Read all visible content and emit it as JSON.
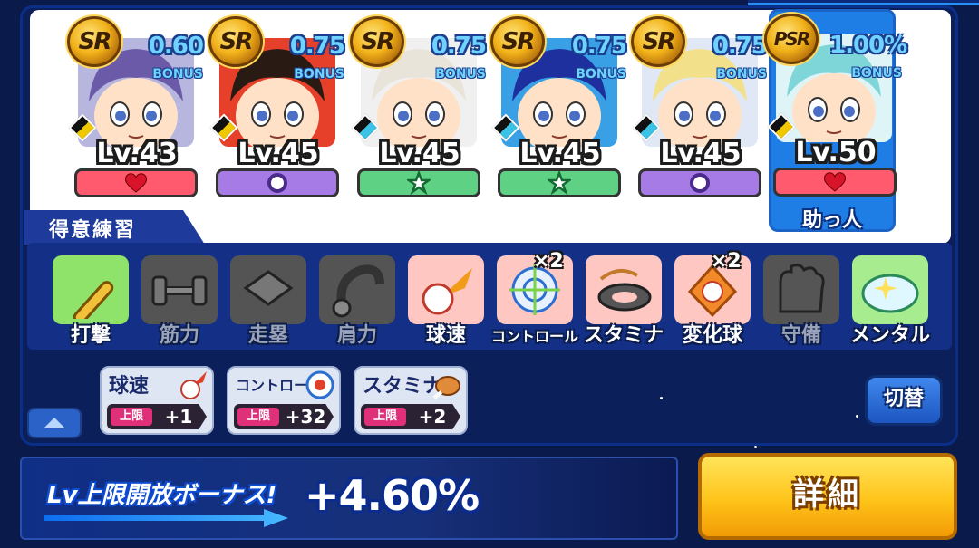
{
  "deck": {
    "cards": [
      {
        "rarity": "SR",
        "bonus": "0.60",
        "bonus_word": "BONUS",
        "level": "Lv.43",
        "type": "heart",
        "type_color": "#ff5a6e",
        "diamond_color": "#f0c800",
        "portrait_bg": "#b7b6df",
        "hair": "#6b5aa8",
        "helper": false
      },
      {
        "rarity": "SR",
        "bonus": "0.75",
        "bonus_word": "BONUS",
        "level": "Lv.45",
        "type": "circle",
        "type_color": "#a77be6",
        "diamond_color": "#f0c800",
        "portrait_bg": "#e6402a",
        "hair": "#2a1a14",
        "helper": false
      },
      {
        "rarity": "SR",
        "bonus": "0.75",
        "bonus_word": "BONUS",
        "level": "Lv.45",
        "type": "star",
        "type_color": "#5fd184",
        "diamond_color": "#3ac3e6",
        "portrait_bg": "#f0f0f0",
        "hair": "#e9e4da",
        "helper": false
      },
      {
        "rarity": "SR",
        "bonus": "0.75",
        "bonus_word": "BONUS",
        "level": "Lv.45",
        "type": "star",
        "type_color": "#5fd184",
        "diamond_color": "#3ac3e6",
        "portrait_bg": "#3aa0e6",
        "hair": "#1e2f9e",
        "helper": false
      },
      {
        "rarity": "SR",
        "bonus": "0.75",
        "bonus_word": "BONUS",
        "level": "Lv.45",
        "type": "circle",
        "type_color": "#a77be6",
        "diamond_color": "#3ac3e6",
        "portrait_bg": "#dfe8f4",
        "hair": "#f2e08a",
        "helper": false
      },
      {
        "rarity": "PSR",
        "bonus": "1.00%",
        "bonus_word": "BONUS",
        "level": "Lv.50",
        "type": "heart",
        "type_color": "#ff5a6e",
        "diamond_color": "#f0c800",
        "portrait_bg": "#dff4f6",
        "hair": "#7fd6d8",
        "helper": true,
        "helper_label": "助っ人"
      }
    ]
  },
  "practice": {
    "title": "得意練習",
    "items": [
      {
        "label": "打撃",
        "active": true,
        "bg": "#8fe36a",
        "icon": "bat-icon",
        "mult": ""
      },
      {
        "label": "筋力",
        "active": false,
        "bg": "#545454",
        "icon": "dumbbell-icon",
        "mult": ""
      },
      {
        "label": "走塁",
        "active": false,
        "bg": "#545454",
        "icon": "base-icon",
        "mult": ""
      },
      {
        "label": "肩力",
        "active": false,
        "bg": "#545454",
        "icon": "band-icon",
        "mult": ""
      },
      {
        "label": "球速",
        "active": true,
        "bg": "#ffc7c2",
        "icon": "fastball-icon",
        "mult": ""
      },
      {
        "label": "コントロール",
        "active": true,
        "bg": "#ffc7c2",
        "icon": "target-icon",
        "mult": "×2"
      },
      {
        "label": "スタミナ",
        "active": true,
        "bg": "#ffc7c2",
        "icon": "tire-icon",
        "mult": ""
      },
      {
        "label": "変化球",
        "active": true,
        "bg": "#ffc7c2",
        "icon": "breaking-ball-icon",
        "mult": "×2"
      },
      {
        "label": "守備",
        "active": false,
        "bg": "#545454",
        "icon": "glove-icon",
        "mult": ""
      },
      {
        "label": "メンタル",
        "active": true,
        "bg": "#a7ec8f",
        "icon": "sparkle-cloud-icon",
        "mult": ""
      }
    ]
  },
  "caps": [
    {
      "name": "球速",
      "tag": "上限",
      "value": "+1",
      "icon": "fastball-icon"
    },
    {
      "name": "コントロール",
      "tag": "上限",
      "value": "+32",
      "icon": "target-icon"
    },
    {
      "name": "スタミナ",
      "tag": "上限",
      "value": "+2",
      "icon": "meat-icon"
    }
  ],
  "buttons": {
    "switch": "切替",
    "detail": "詳細"
  },
  "bonus_banner": {
    "label": "Lv上限開放ボーナス!",
    "value": "+4.60%"
  }
}
